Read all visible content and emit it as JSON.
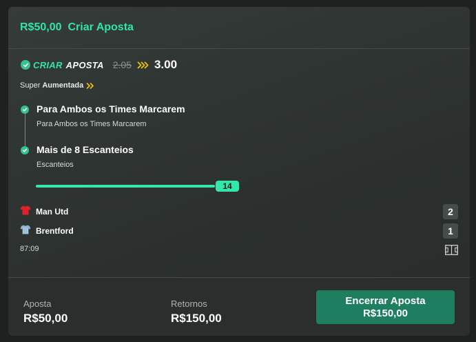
{
  "header": {
    "amount": "R$50,00",
    "title": "Criar Aposta"
  },
  "betbuilder": {
    "label_part1": "CRIAR",
    "label_part2": "APOSTA",
    "old_odds": "2.05",
    "new_odds": "3.00"
  },
  "boost": {
    "prefix": "Super",
    "label": "Aumentada"
  },
  "selections": [
    {
      "title": "Para Ambos os Times Marcarem",
      "market": "Para Ambos os Times Marcarem"
    },
    {
      "title": "Mais de 8 Escanteios",
      "market": "Escanteios"
    }
  ],
  "slider": {
    "value": "14",
    "fill_fraction": 0.93
  },
  "teams": [
    {
      "name": "Man Utd",
      "score": "2",
      "shirt_color": "#e0202a"
    },
    {
      "name": "Brentford",
      "score": "1",
      "shirt_color": "#8fb4cf"
    }
  ],
  "match_time": "87:09",
  "footer": {
    "stake_label": "Aposta",
    "stake_value": "R$50,00",
    "returns_label": "Retornos",
    "returns_value": "R$150,00",
    "cashout_label": "Encerrar Aposta",
    "cashout_value": "R$150,00"
  },
  "colors": {
    "accent": "#2ee6a6",
    "boost_chevron": "#f5c400",
    "cashout_button": "#1d7f5f"
  },
  "icons": {
    "check": "check-circle-icon",
    "boost": "double-chevron-icon",
    "shirt": "jersey-icon",
    "pitch": "pitch-icon"
  }
}
